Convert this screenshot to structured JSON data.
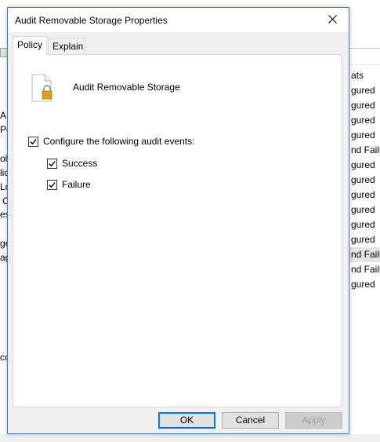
{
  "dialog": {
    "title": "Audit Removable Storage Properties",
    "close_icon": "close-icon",
    "tabs": [
      {
        "label": "Policy",
        "active": true
      },
      {
        "label": "Explain",
        "active": false
      }
    ],
    "policy_icon": "document-lock-icon",
    "policy_name": "Audit Removable Storage",
    "configure_label": "Configure the following audit events:",
    "configure_checked": true,
    "success_label": "Success",
    "success_checked": true,
    "failure_label": "Failure",
    "failure_checked": true,
    "buttons": {
      "ok": "OK",
      "cancel": "Cancel",
      "apply": "Apply"
    },
    "apply_enabled": false
  },
  "background": {
    "left_fragments": [
      "A",
      "Po",
      "oli",
      "lic",
      "Lo",
      "C",
      "es",
      "ge",
      "ag",
      "co"
    ],
    "right_header": "ats",
    "right_cells": [
      "gured",
      "gured",
      "gured",
      "gured",
      "nd Failur",
      "gured",
      "gured",
      "gured",
      "gured",
      "gured",
      "gured",
      "nd Failur",
      "nd Failur",
      "gured"
    ],
    "right_selected_index": 11
  },
  "colors": {
    "accent": "#0078d7",
    "dialog_border": "#3c7fb1",
    "dialog_bg": "#f0f0f0",
    "lock": "#e0a81c"
  }
}
